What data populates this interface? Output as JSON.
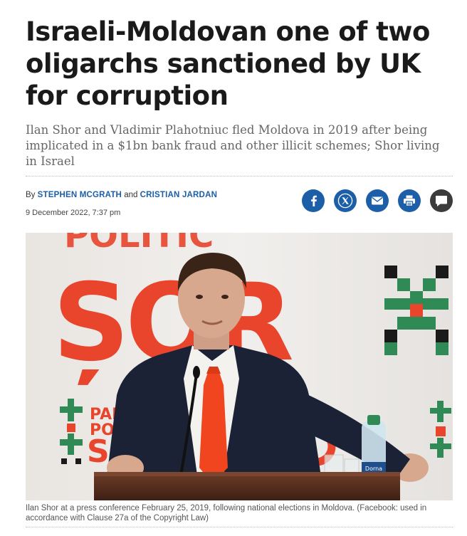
{
  "article": {
    "headline": "Israeli-Moldovan one of two oligarchs sanctioned by UK for corruption",
    "subheadline": "Ilan Shor and Vladimir Plahotniuc fled Moldova in 2019 after being implicated in a $1bn bank fraud and other illicit schemes; Shor living in Israel",
    "byline_prefix": "By",
    "author_1": "STEPHEN MCGRATH",
    "byline_and": "and",
    "author_2": "CRISTIAN JARDAN",
    "date": "9 December 2022, 7:37 pm"
  },
  "share": {
    "items": [
      {
        "icon": "facebook-icon",
        "color": "#1c5ea8"
      },
      {
        "icon": "x-icon",
        "color": "#1c5ea8"
      },
      {
        "icon": "email-icon",
        "color": "#1c5ea8"
      },
      {
        "icon": "print-icon",
        "color": "#1c5ea8"
      },
      {
        "icon": "comment-icon",
        "color": "#3c3c3c"
      }
    ]
  },
  "photo": {
    "backdrop_text": "ȘOR",
    "backdrop_top_text": "POLITIC",
    "backdrop_small_text_1": "PAR",
    "backdrop_small_text_2": "PO",
    "backdrop_small_text_3": "S",
    "bottle_label": "Dorna",
    "caption": "Ilan Shor at a press conference February 25, 2019, following national elections in Moldova. (Facebook: used in accordance with Clause 27a of the Copyright Law)"
  },
  "colors": {
    "accent": "#1c5ea8",
    "party_red": "#e8452c",
    "party_green": "#2f8a55"
  }
}
